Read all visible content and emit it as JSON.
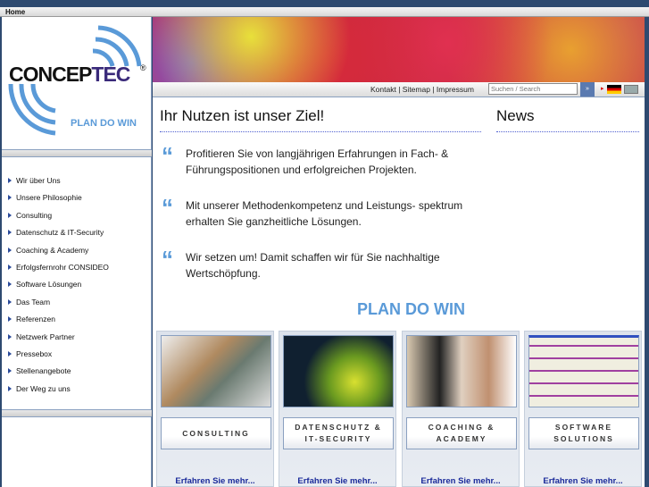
{
  "topbar": {
    "home": "Home"
  },
  "logo": {
    "name": "CONCEPTEC",
    "reg": "®",
    "tagline": "PLAN DO WIN"
  },
  "nav": [
    "Wir über Uns",
    "Unsere Philosophie",
    "Consulting",
    "Datenschutz & IT-Security",
    "Coaching & Academy",
    "Erfolgsfernrohr CONSIDEO",
    "Software Lösungen",
    "Das Team",
    "Referenzen",
    "Netzwerk Partner",
    "Pressebox",
    "Stellenangebote",
    "Der Weg zu uns"
  ],
  "links": {
    "kontakt": "Kontakt",
    "sitemap": "Sitemap",
    "impressum": "Impressum",
    "sep": " | "
  },
  "search": {
    "placeholder": "Suchen / Search",
    "go": "»"
  },
  "main": {
    "title": "Ihr Nutzen ist unser Ziel!",
    "news": "News",
    "claims": [
      "Profitieren Sie von langjährigen Erfahrungen in Fach- & Führungspositionen und erfolgreichen Projekten.",
      "Mit unserer Methodenkompetenz und Leistungs- spektrum erhalten Sie ganzheitliche Lösungen.",
      "Wir setzen um! Damit schaffen wir für Sie nachhaltige Wertschöpfung."
    ],
    "slogan": "PLAN DO WIN"
  },
  "cards": [
    {
      "label": "CONSULTING",
      "more": "Erfahren Sie mehr..."
    },
    {
      "label": "DATENSCHUTZ &\nIT-SECURITY",
      "more": "Erfahren Sie mehr..."
    },
    {
      "label": "COACHING &\nACADEMY",
      "more": "Erfahren Sie mehr..."
    },
    {
      "label": "SOFTWARE\nSOLUTIONS",
      "more": "Erfahren Sie mehr..."
    }
  ],
  "colors": {
    "accent": "#5a9ad8",
    "link": "#1a2a9a",
    "frame": "#2e4a70"
  }
}
